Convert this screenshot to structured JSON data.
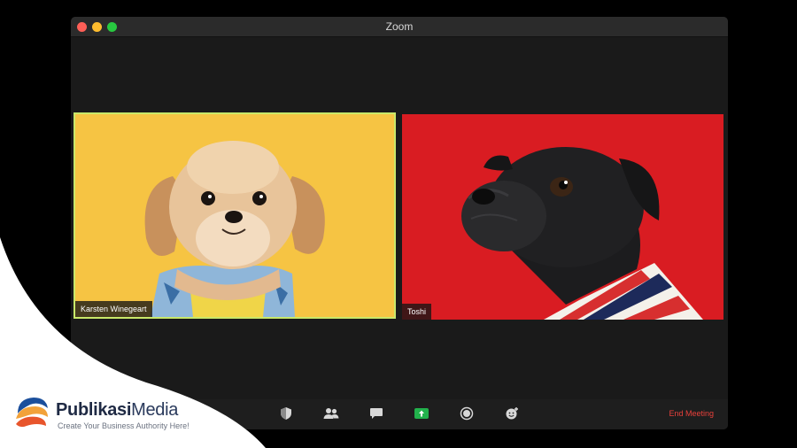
{
  "window": {
    "title": "Zoom",
    "traffic_lights": [
      "close",
      "minimize",
      "maximize"
    ]
  },
  "participants": [
    {
      "name": "Karsten Winegeart",
      "active_speaker": true,
      "background_color": "#f6c443"
    },
    {
      "name": "Toshi",
      "active_speaker": false,
      "background_color": "#d91c22"
    }
  ],
  "toolbar": {
    "icons": [
      "security-icon",
      "participants-icon",
      "chat-icon",
      "share-screen-icon",
      "record-icon",
      "reactions-icon"
    ],
    "share_color": "#22b24c",
    "end_label": "End Meeting",
    "end_color": "#e8403b"
  },
  "watermark": {
    "name_bold": "Publikasi",
    "name_light": "Media",
    "tagline": "Create Your Business Authority Here!"
  }
}
